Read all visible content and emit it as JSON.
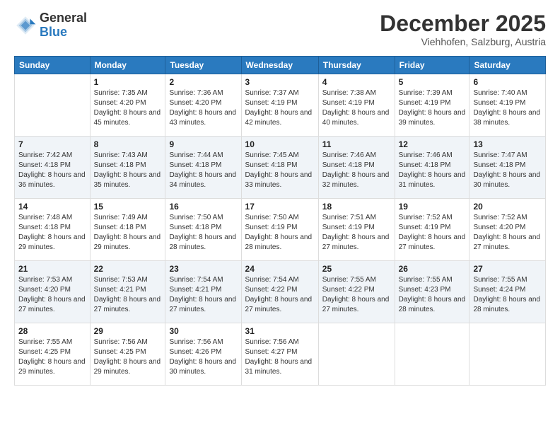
{
  "header": {
    "logo_general": "General",
    "logo_blue": "Blue",
    "month_title": "December 2025",
    "location": "Viehhofen, Salzburg, Austria"
  },
  "days_of_week": [
    "Sunday",
    "Monday",
    "Tuesday",
    "Wednesday",
    "Thursday",
    "Friday",
    "Saturday"
  ],
  "weeks": [
    [
      {
        "day": "",
        "sunrise": "",
        "sunset": "",
        "daylight": ""
      },
      {
        "day": "1",
        "sunrise": "Sunrise: 7:35 AM",
        "sunset": "Sunset: 4:20 PM",
        "daylight": "Daylight: 8 hours and 45 minutes."
      },
      {
        "day": "2",
        "sunrise": "Sunrise: 7:36 AM",
        "sunset": "Sunset: 4:20 PM",
        "daylight": "Daylight: 8 hours and 43 minutes."
      },
      {
        "day": "3",
        "sunrise": "Sunrise: 7:37 AM",
        "sunset": "Sunset: 4:19 PM",
        "daylight": "Daylight: 8 hours and 42 minutes."
      },
      {
        "day": "4",
        "sunrise": "Sunrise: 7:38 AM",
        "sunset": "Sunset: 4:19 PM",
        "daylight": "Daylight: 8 hours and 40 minutes."
      },
      {
        "day": "5",
        "sunrise": "Sunrise: 7:39 AM",
        "sunset": "Sunset: 4:19 PM",
        "daylight": "Daylight: 8 hours and 39 minutes."
      },
      {
        "day": "6",
        "sunrise": "Sunrise: 7:40 AM",
        "sunset": "Sunset: 4:19 PM",
        "daylight": "Daylight: 8 hours and 38 minutes."
      }
    ],
    [
      {
        "day": "7",
        "sunrise": "Sunrise: 7:42 AM",
        "sunset": "Sunset: 4:18 PM",
        "daylight": "Daylight: 8 hours and 36 minutes."
      },
      {
        "day": "8",
        "sunrise": "Sunrise: 7:43 AM",
        "sunset": "Sunset: 4:18 PM",
        "daylight": "Daylight: 8 hours and 35 minutes."
      },
      {
        "day": "9",
        "sunrise": "Sunrise: 7:44 AM",
        "sunset": "Sunset: 4:18 PM",
        "daylight": "Daylight: 8 hours and 34 minutes."
      },
      {
        "day": "10",
        "sunrise": "Sunrise: 7:45 AM",
        "sunset": "Sunset: 4:18 PM",
        "daylight": "Daylight: 8 hours and 33 minutes."
      },
      {
        "day": "11",
        "sunrise": "Sunrise: 7:46 AM",
        "sunset": "Sunset: 4:18 PM",
        "daylight": "Daylight: 8 hours and 32 minutes."
      },
      {
        "day": "12",
        "sunrise": "Sunrise: 7:46 AM",
        "sunset": "Sunset: 4:18 PM",
        "daylight": "Daylight: 8 hours and 31 minutes."
      },
      {
        "day": "13",
        "sunrise": "Sunrise: 7:47 AM",
        "sunset": "Sunset: 4:18 PM",
        "daylight": "Daylight: 8 hours and 30 minutes."
      }
    ],
    [
      {
        "day": "14",
        "sunrise": "Sunrise: 7:48 AM",
        "sunset": "Sunset: 4:18 PM",
        "daylight": "Daylight: 8 hours and 29 minutes."
      },
      {
        "day": "15",
        "sunrise": "Sunrise: 7:49 AM",
        "sunset": "Sunset: 4:18 PM",
        "daylight": "Daylight: 8 hours and 29 minutes."
      },
      {
        "day": "16",
        "sunrise": "Sunrise: 7:50 AM",
        "sunset": "Sunset: 4:18 PM",
        "daylight": "Daylight: 8 hours and 28 minutes."
      },
      {
        "day": "17",
        "sunrise": "Sunrise: 7:50 AM",
        "sunset": "Sunset: 4:19 PM",
        "daylight": "Daylight: 8 hours and 28 minutes."
      },
      {
        "day": "18",
        "sunrise": "Sunrise: 7:51 AM",
        "sunset": "Sunset: 4:19 PM",
        "daylight": "Daylight: 8 hours and 27 minutes."
      },
      {
        "day": "19",
        "sunrise": "Sunrise: 7:52 AM",
        "sunset": "Sunset: 4:19 PM",
        "daylight": "Daylight: 8 hours and 27 minutes."
      },
      {
        "day": "20",
        "sunrise": "Sunrise: 7:52 AM",
        "sunset": "Sunset: 4:20 PM",
        "daylight": "Daylight: 8 hours and 27 minutes."
      }
    ],
    [
      {
        "day": "21",
        "sunrise": "Sunrise: 7:53 AM",
        "sunset": "Sunset: 4:20 PM",
        "daylight": "Daylight: 8 hours and 27 minutes."
      },
      {
        "day": "22",
        "sunrise": "Sunrise: 7:53 AM",
        "sunset": "Sunset: 4:21 PM",
        "daylight": "Daylight: 8 hours and 27 minutes."
      },
      {
        "day": "23",
        "sunrise": "Sunrise: 7:54 AM",
        "sunset": "Sunset: 4:21 PM",
        "daylight": "Daylight: 8 hours and 27 minutes."
      },
      {
        "day": "24",
        "sunrise": "Sunrise: 7:54 AM",
        "sunset": "Sunset: 4:22 PM",
        "daylight": "Daylight: 8 hours and 27 minutes."
      },
      {
        "day": "25",
        "sunrise": "Sunrise: 7:55 AM",
        "sunset": "Sunset: 4:22 PM",
        "daylight": "Daylight: 8 hours and 27 minutes."
      },
      {
        "day": "26",
        "sunrise": "Sunrise: 7:55 AM",
        "sunset": "Sunset: 4:23 PM",
        "daylight": "Daylight: 8 hours and 28 minutes."
      },
      {
        "day": "27",
        "sunrise": "Sunrise: 7:55 AM",
        "sunset": "Sunset: 4:24 PM",
        "daylight": "Daylight: 8 hours and 28 minutes."
      }
    ],
    [
      {
        "day": "28",
        "sunrise": "Sunrise: 7:55 AM",
        "sunset": "Sunset: 4:25 PM",
        "daylight": "Daylight: 8 hours and 29 minutes."
      },
      {
        "day": "29",
        "sunrise": "Sunrise: 7:56 AM",
        "sunset": "Sunset: 4:25 PM",
        "daylight": "Daylight: 8 hours and 29 minutes."
      },
      {
        "day": "30",
        "sunrise": "Sunrise: 7:56 AM",
        "sunset": "Sunset: 4:26 PM",
        "daylight": "Daylight: 8 hours and 30 minutes."
      },
      {
        "day": "31",
        "sunrise": "Sunrise: 7:56 AM",
        "sunset": "Sunset: 4:27 PM",
        "daylight": "Daylight: 8 hours and 31 minutes."
      },
      {
        "day": "",
        "sunrise": "",
        "sunset": "",
        "daylight": ""
      },
      {
        "day": "",
        "sunrise": "",
        "sunset": "",
        "daylight": ""
      },
      {
        "day": "",
        "sunrise": "",
        "sunset": "",
        "daylight": ""
      }
    ]
  ]
}
